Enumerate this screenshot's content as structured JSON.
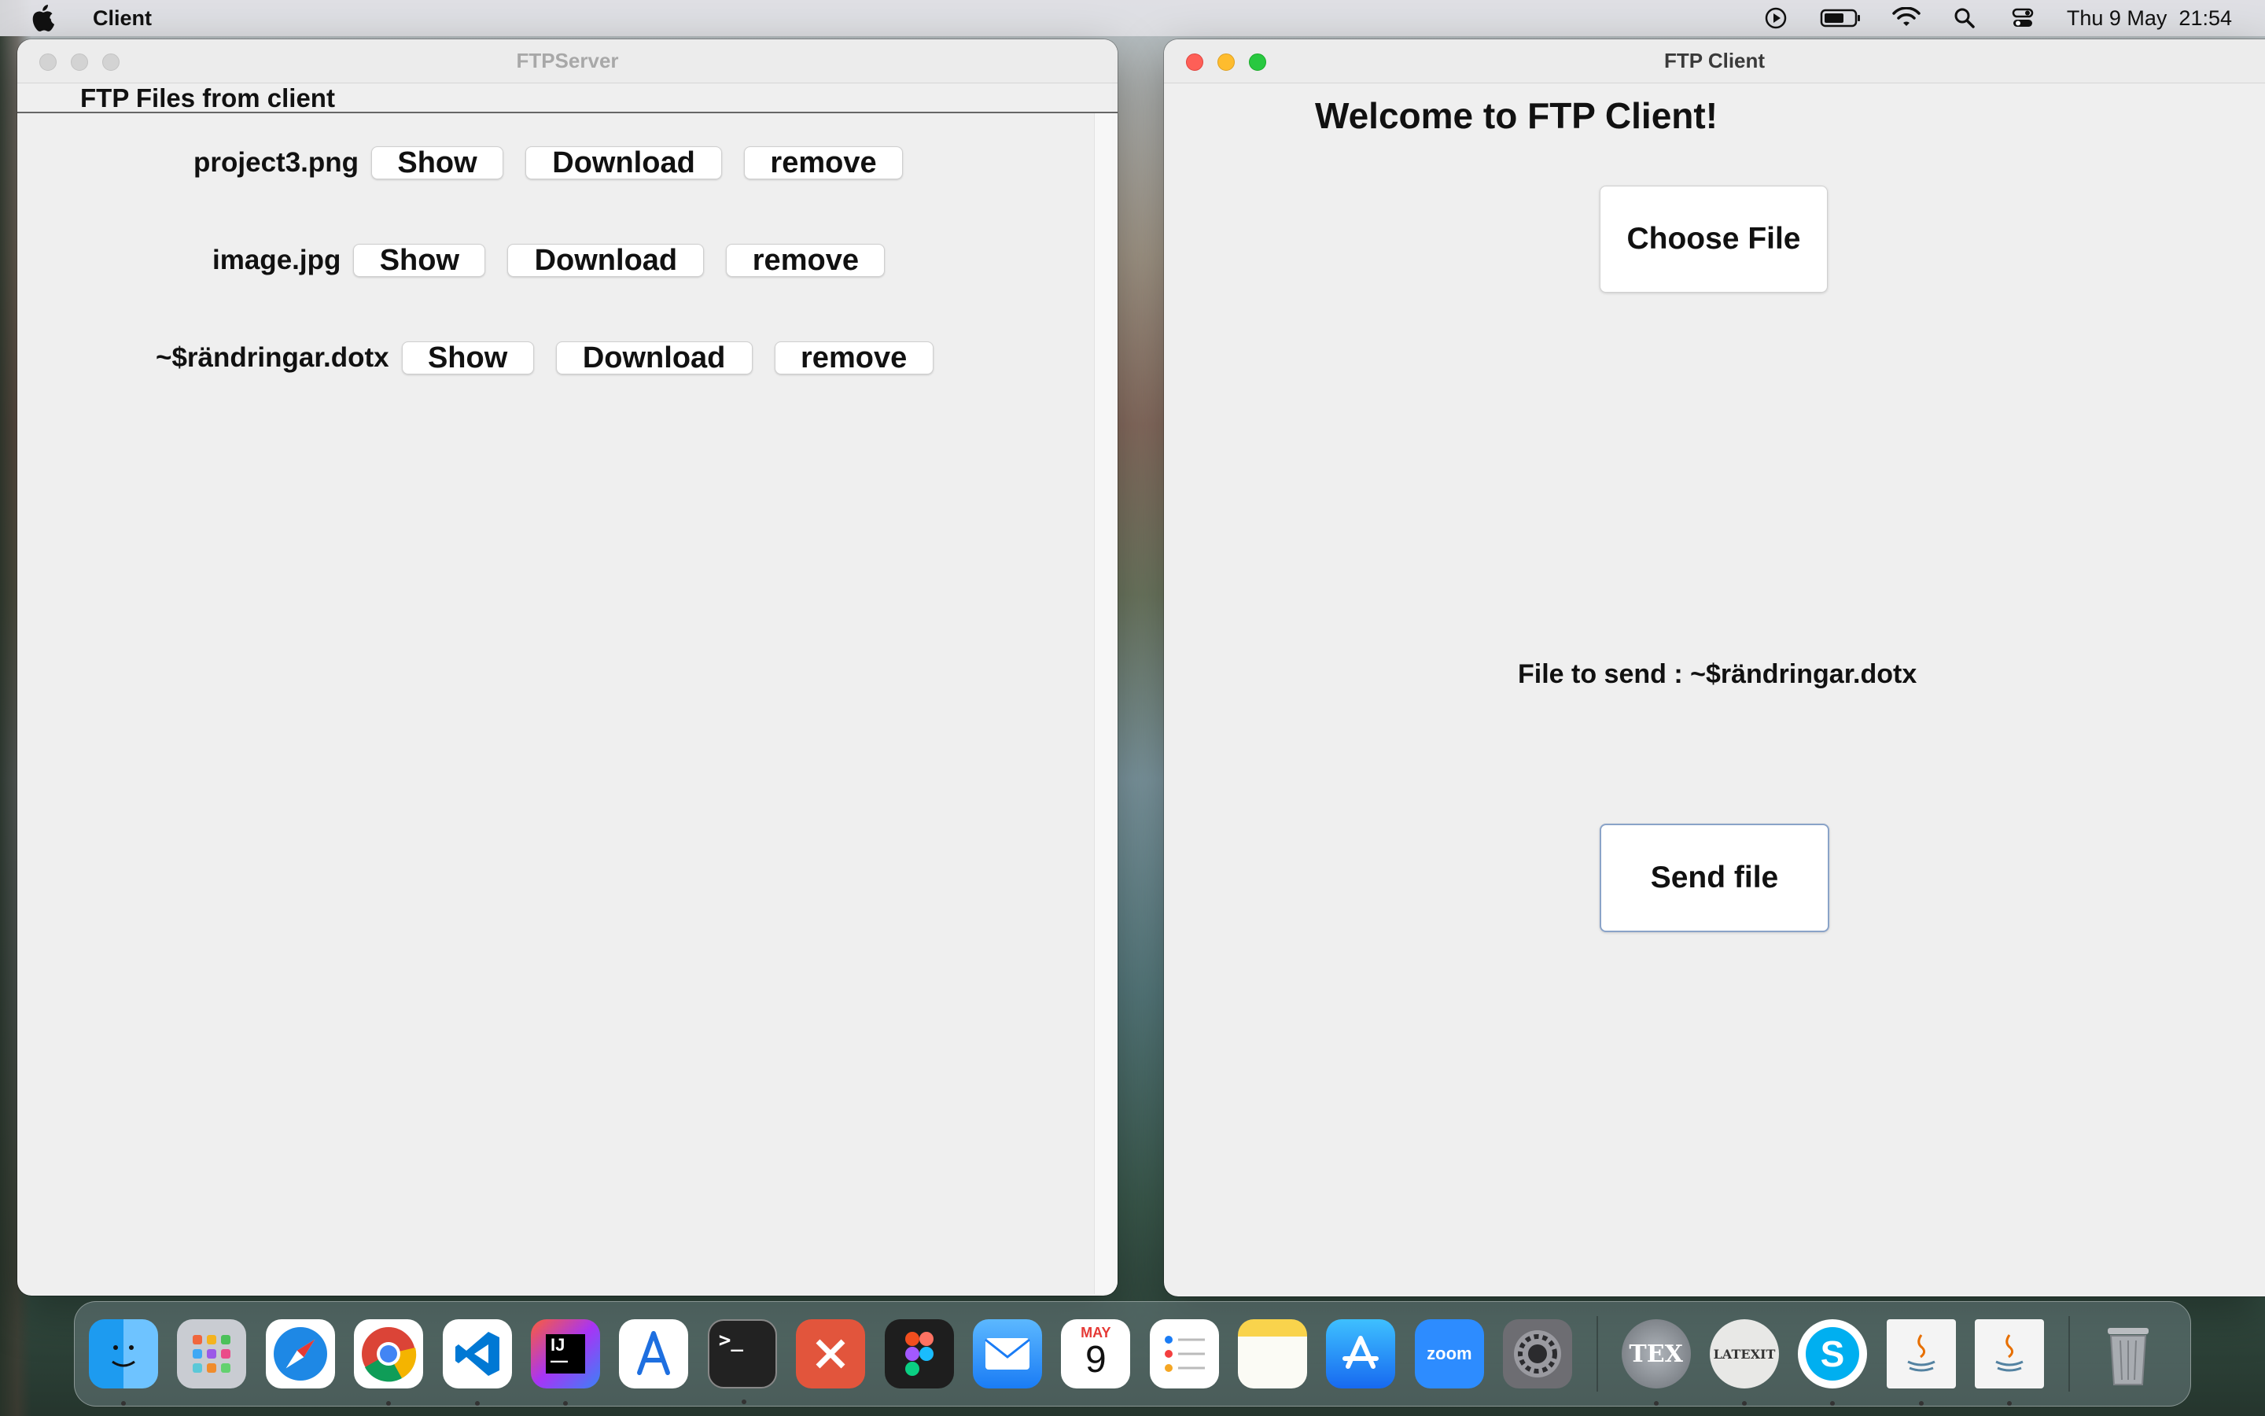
{
  "menubar": {
    "app_name": "Client",
    "datetime": "Thu 9 May  21:54"
  },
  "server_window": {
    "title": "FTPServer",
    "header": "FTP Files from client",
    "files": [
      {
        "name": "project3.png",
        "show": "Show",
        "download": "Download",
        "remove": "remove"
      },
      {
        "name": "image.jpg",
        "show": "Show",
        "download": "Download",
        "remove": "remove"
      },
      {
        "name": "~$rändringar.dotx",
        "show": "Show",
        "download": "Download",
        "remove": "remove"
      }
    ]
  },
  "client_window": {
    "title": "FTP Client",
    "welcome": "Welcome to FTP Client!",
    "choose_label": "Choose File",
    "file_to_send": "File to send : ~$rändringar.dotx",
    "send_label": "Send file"
  },
  "dock": {
    "items": [
      "finder-icon",
      "launchpad-icon",
      "safari-icon",
      "chrome-icon",
      "vscode-icon",
      "intellij-icon",
      "instruments-icon",
      "terminal-icon",
      "remote-desktop-icon",
      "figma-icon",
      "mail-icon",
      "calendar-icon",
      "reminders-icon",
      "notes-icon",
      "app-store-icon",
      "zoom-icon",
      "system-settings-icon",
      "tex-icon",
      "latexit-icon",
      "skype-icon",
      "java-icon",
      "java-icon-2",
      "trash-icon"
    ],
    "calendar_month": "MAY",
    "calendar_day": "9",
    "zoom_label": "zoom",
    "tex_label": "TEX",
    "latexit_label": "LATEXIT"
  }
}
